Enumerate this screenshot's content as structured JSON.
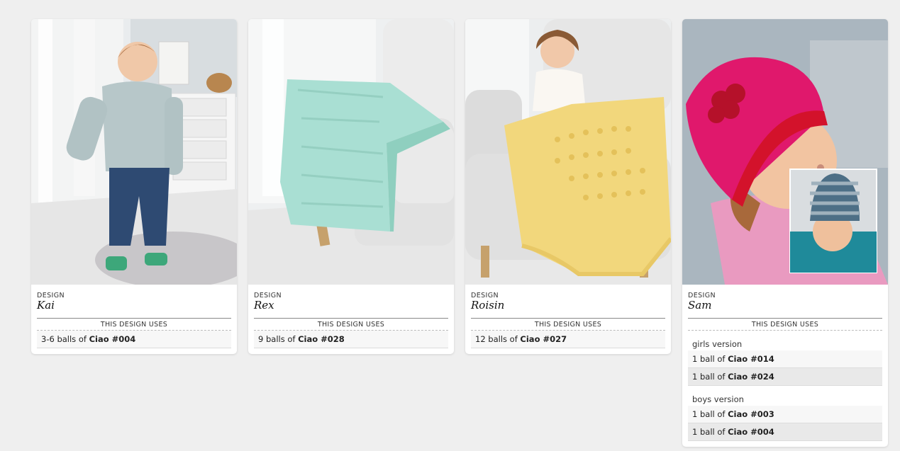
{
  "cards": [
    {
      "design_label": "DESIGN",
      "name": "Kai",
      "uses_label": "THIS DESIGN USES",
      "rows": [
        {
          "prefix": "3-6 balls of ",
          "yarn": "Ciao #004"
        }
      ]
    },
    {
      "design_label": "DESIGN",
      "name": "Rex",
      "uses_label": "THIS DESIGN USES",
      "rows": [
        {
          "prefix": "9 balls of ",
          "yarn": "Ciao #028"
        }
      ]
    },
    {
      "design_label": "DESIGN",
      "name": "Roisin",
      "uses_label": "THIS DESIGN USES",
      "rows": [
        {
          "prefix": "12 balls of ",
          "yarn": "Ciao #027"
        }
      ]
    },
    {
      "design_label": "DESIGN",
      "name": "Sam",
      "uses_label": "THIS DESIGN USES",
      "versions": [
        {
          "label": "girls version",
          "rows": [
            {
              "prefix": "1 ball of ",
              "yarn": "Ciao #014"
            },
            {
              "prefix": "1 ball of ",
              "yarn": "Ciao #024"
            }
          ]
        },
        {
          "label": "boys version",
          "rows": [
            {
              "prefix": "1 ball of ",
              "yarn": "Ciao #003"
            },
            {
              "prefix": "1 ball of ",
              "yarn": "Ciao #004"
            }
          ]
        }
      ]
    }
  ],
  "colors": {
    "background": "#efefef",
    "card": "#ffffff",
    "mint_blanket": "#a9dfd3",
    "yellow_blanket": "#f2d77c",
    "pink_hat": "#e0186c",
    "red_brim": "#d3122b"
  }
}
